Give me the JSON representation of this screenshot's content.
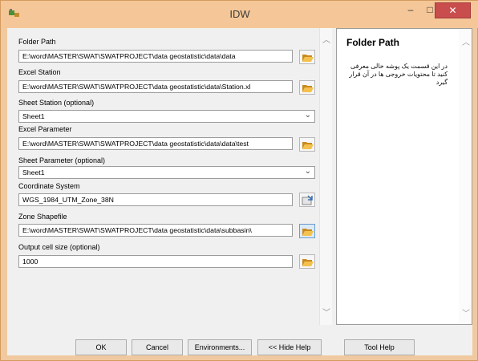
{
  "window": {
    "title": "IDW",
    "minimize_glyph": "–",
    "maximize_glyph": "□",
    "close_glyph": "✕"
  },
  "params": [
    {
      "label": "Folder Path",
      "value": "E:\\word\\MASTER\\SWAT\\SWATPROJECT\\data geostatistic\\data\\data"
    },
    {
      "label": "Excel Station",
      "value": "E:\\word\\MASTER\\SWAT\\SWATPROJECT\\data geostatistic\\data\\Station.xl"
    },
    {
      "label": "Sheet Station (optional)",
      "value": "Sheet1"
    },
    {
      "label": "Excel Parameter",
      "value": "E:\\word\\MASTER\\SWAT\\SWATPROJECT\\data geostatistic\\data\\data\\test"
    },
    {
      "label": "Sheet Parameter (optional)",
      "value": "Sheet1"
    },
    {
      "label": "Coordinate System",
      "value": "WGS_1984_UTM_Zone_38N"
    },
    {
      "label": "Zone Shapefile",
      "value": "E:\\word\\MASTER\\SWAT\\SWATPROJECT\\data geostatistic\\data\\subbasin\\"
    },
    {
      "label": "Output cell size (optional)",
      "value": "1000"
    }
  ],
  "help": {
    "title": "Folder Path",
    "text": "در این قسمت یک پوشه خالی معرفی کنید تا محتویات خروجی ها در آن قرار گیرد"
  },
  "buttons": {
    "ok": "OK",
    "cancel": "Cancel",
    "environments": "Environments...",
    "hide_help": "<< Hide Help",
    "tool_help": "Tool Help"
  },
  "icons": {
    "app": "toolbox-icon",
    "folder": "open-folder-icon",
    "coordinate": "spatial-reference-icon"
  }
}
